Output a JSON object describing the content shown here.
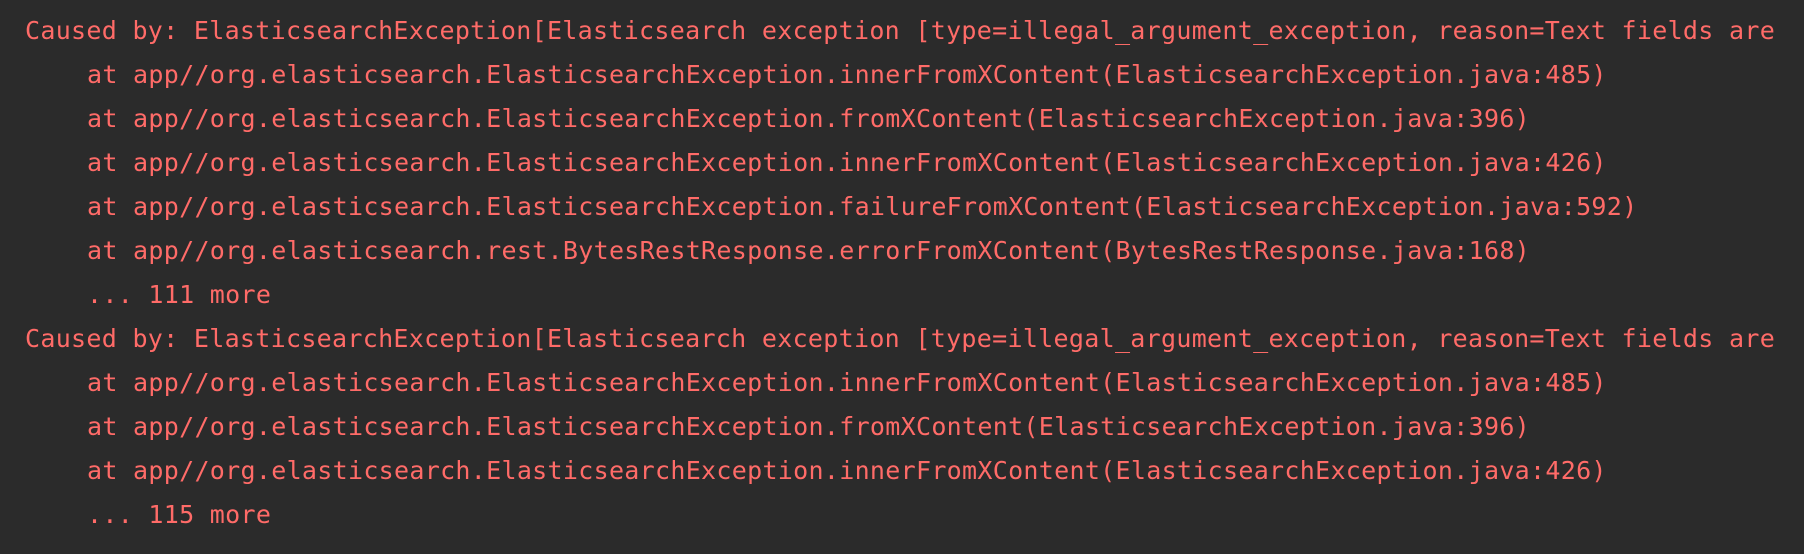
{
  "console": {
    "lines": [
      {
        "kind": "caused",
        "text": "Caused by: ElasticsearchException[Elasticsearch exception [type=illegal_argument_exception, reason=Text fields are"
      },
      {
        "kind": "frame",
        "text": "at app//org.elasticsearch.ElasticsearchException.innerFromXContent(ElasticsearchException.java:485)"
      },
      {
        "kind": "frame",
        "text": "at app//org.elasticsearch.ElasticsearchException.fromXContent(ElasticsearchException.java:396)"
      },
      {
        "kind": "frame",
        "text": "at app//org.elasticsearch.ElasticsearchException.innerFromXContent(ElasticsearchException.java:426)"
      },
      {
        "kind": "frame",
        "text": "at app//org.elasticsearch.ElasticsearchException.failureFromXContent(ElasticsearchException.java:592)"
      },
      {
        "kind": "frame",
        "text": "at app//org.elasticsearch.rest.BytesRestResponse.errorFromXContent(BytesRestResponse.java:168)"
      },
      {
        "kind": "frame",
        "text": "... 111 more"
      },
      {
        "kind": "caused",
        "text": "Caused by: ElasticsearchException[Elasticsearch exception [type=illegal_argument_exception, reason=Text fields are"
      },
      {
        "kind": "frame",
        "text": "at app//org.elasticsearch.ElasticsearchException.innerFromXContent(ElasticsearchException.java:485)"
      },
      {
        "kind": "frame",
        "text": "at app//org.elasticsearch.ElasticsearchException.fromXContent(ElasticsearchException.java:396)"
      },
      {
        "kind": "frame",
        "text": "at app//org.elasticsearch.ElasticsearchException.innerFromXContent(ElasticsearchException.java:426)"
      },
      {
        "kind": "frame",
        "text": "... 115 more"
      }
    ],
    "colors": {
      "background": "#2b2b2b",
      "error_text": "#ff6b68"
    }
  }
}
